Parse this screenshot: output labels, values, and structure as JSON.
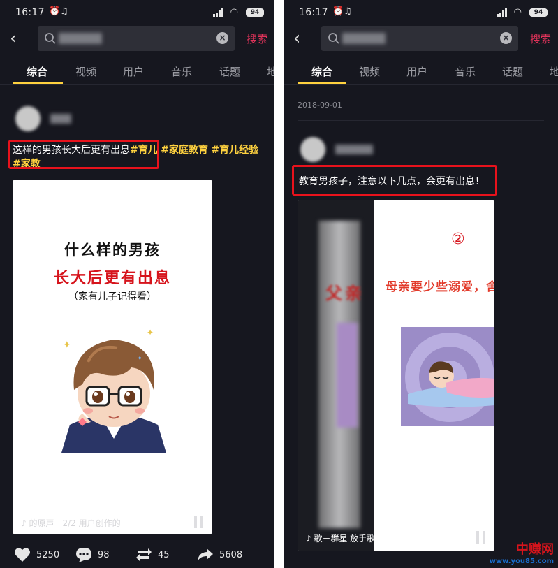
{
  "status": {
    "time": "16:17",
    "battery": "94"
  },
  "search": {
    "query": "",
    "button_label": "搜索"
  },
  "tabs": [
    "综合",
    "视频",
    "用户",
    "音乐",
    "话题",
    "地"
  ],
  "left": {
    "caption_text": "这样的男孩长大后更有出息",
    "hashtags": [
      "#育儿",
      "#家庭教育",
      "#育儿经验",
      "#家教"
    ],
    "cover": {
      "line1": "什么样的男孩",
      "line2": "长大后更有出息",
      "line3": "（家有儿子记得看）"
    },
    "music_text": "的原声－2/2  用户创作的",
    "stats": {
      "likes": "5250",
      "comments": "98",
      "shares": "45",
      "forwards": "5608"
    }
  },
  "right": {
    "date": "2018-09-01",
    "caption_text": "教育男孩子，注意以下几点，会更有出息！",
    "cover": {
      "number": "②",
      "banner": "母亲要少些溺爱，舍得让",
      "left_text": "父亲"
    },
    "music_text": "歌－群星    放手歌－群星"
  },
  "watermark": {
    "cn": "中赚网",
    "url": "www.you85.com"
  },
  "colors": {
    "background": "#16171f",
    "accent_tag": "#ffd23f",
    "search_button": "#e0335a",
    "highlight_box": "#e8121c"
  }
}
